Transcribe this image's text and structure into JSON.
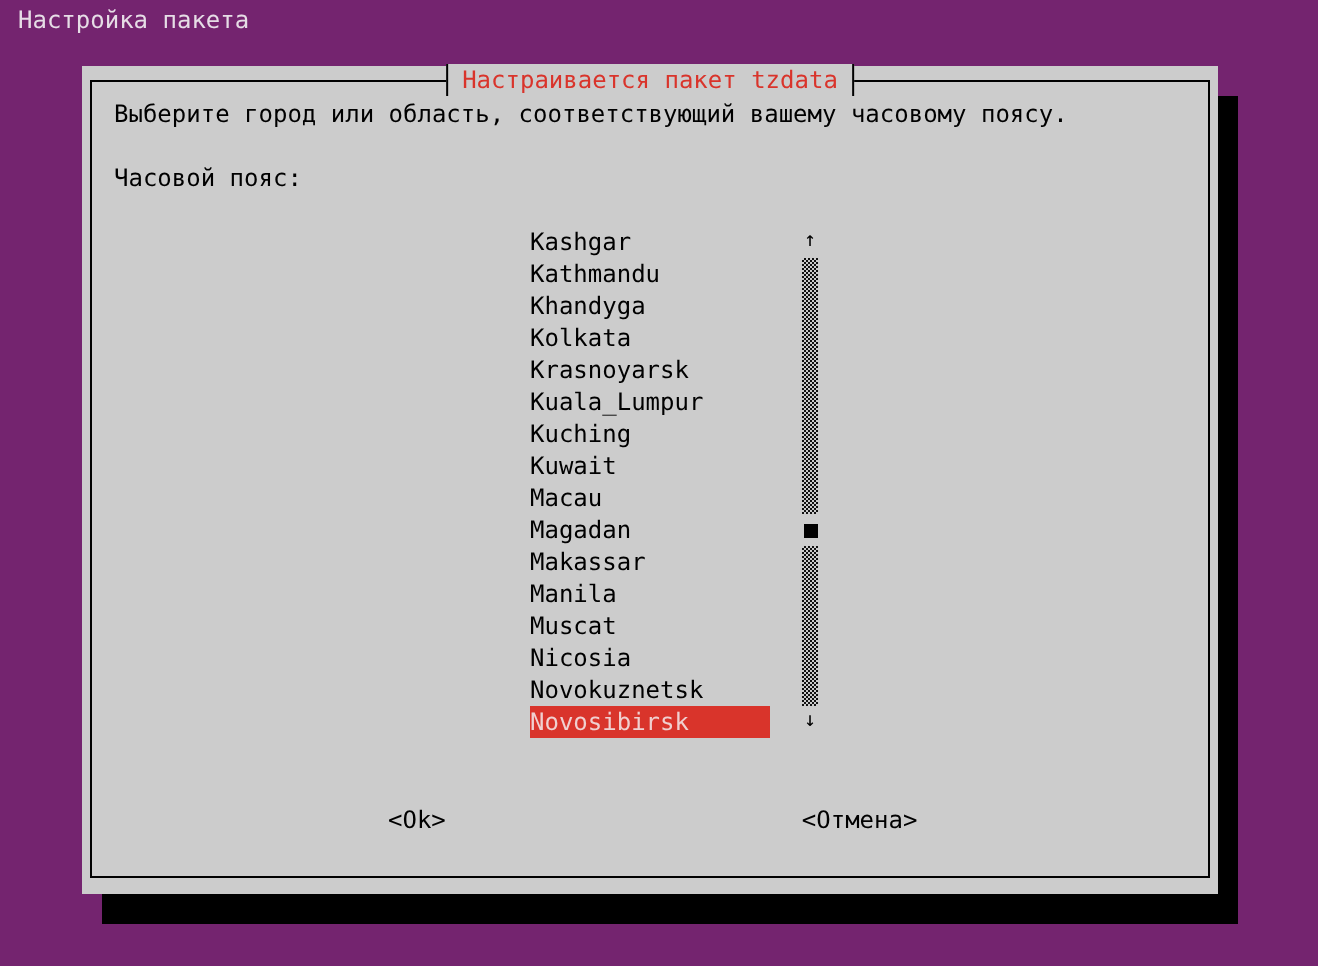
{
  "header": {
    "title": "Настройка пакета"
  },
  "dialog": {
    "title": "Настраивается пакет tzdata",
    "prompt": "Выберите город или область, соответствующий вашему часовому поясу.",
    "label": "Часовой пояс:",
    "items": [
      {
        "label": "Kashgar",
        "selected": false
      },
      {
        "label": "Kathmandu",
        "selected": false
      },
      {
        "label": "Khandyga",
        "selected": false
      },
      {
        "label": "Kolkata",
        "selected": false
      },
      {
        "label": "Krasnoyarsk",
        "selected": false
      },
      {
        "label": "Kuala_Lumpur",
        "selected": false
      },
      {
        "label": "Kuching",
        "selected": false
      },
      {
        "label": "Kuwait",
        "selected": false
      },
      {
        "label": "Macau",
        "selected": false
      },
      {
        "label": "Magadan",
        "selected": false
      },
      {
        "label": "Makassar",
        "selected": false
      },
      {
        "label": "Manila",
        "selected": false
      },
      {
        "label": "Muscat",
        "selected": false
      },
      {
        "label": "Nicosia",
        "selected": false
      },
      {
        "label": "Novokuznetsk",
        "selected": false
      },
      {
        "label": "Novosibirsk",
        "selected": true
      }
    ],
    "scroll_up": "↑",
    "scroll_down": "↓",
    "buttons": [
      "<Ok>",
      "<Отмена>"
    ]
  }
}
